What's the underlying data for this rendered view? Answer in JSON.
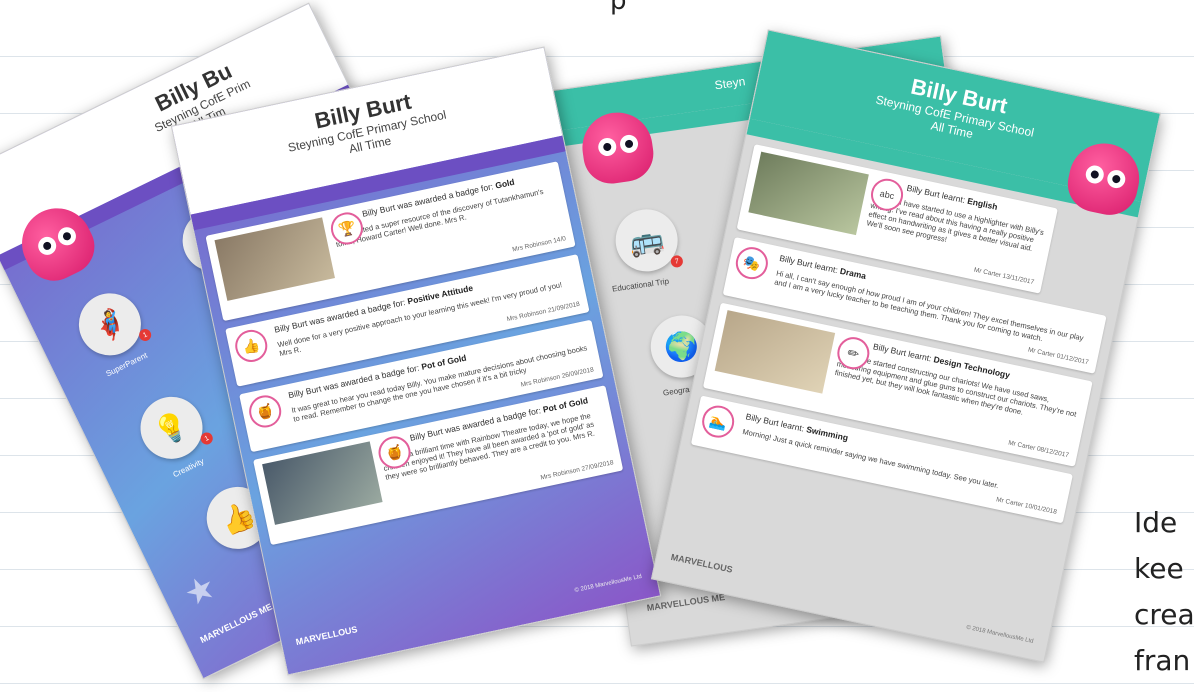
{
  "top_text": "p",
  "side_note": [
    "Ide",
    "kee",
    "crea",
    "fran"
  ],
  "sheet1": {
    "name": "Billy Bu",
    "school": "Steyning CofE Prim",
    "period": "All Tim",
    "badges": [
      {
        "label": "SuperParent",
        "icon": "superparent-icon",
        "count": "1"
      },
      {
        "label": "Creativity",
        "icon": "creativity-icon",
        "count": "1"
      },
      {
        "label": "",
        "icon": "gold-pot-icon",
        "count": ""
      },
      {
        "label": "",
        "icon": "thumbs-up-icon",
        "count": ""
      }
    ],
    "logo": "MARVELLOUS ME",
    "logo2": "MARVELLOUS"
  },
  "sheet2": {
    "name": "Billy Burt",
    "school": "Steyning CofE Primary School",
    "period": "All Time",
    "cards": [
      {
        "title_prefix": "Billy Burt was awarded a badge for:",
        "title_bold": "Gold",
        "body": "You created a super resource of the discovery of Tutankhamun's tomb, Howard Carter! Well done. Mrs R.",
        "meta": "Mrs Robinson 14/0",
        "icon": "trophy-icon",
        "photo": true
      },
      {
        "title_prefix": "Billy Burt was awarded a badge for:",
        "title_bold": "Positive Attitude",
        "body": "Well done for a very positive approach to your learning this week! I'm very proud of you! Mrs R.",
        "meta": "Mrs Robinson 21/09/2018",
        "icon": "thumbs-up-icon",
        "photo": false
      },
      {
        "title_prefix": "Billy Burt was awarded a badge for:",
        "title_bold": "Pot of Gold",
        "body": "It was great to hear you read today Billy. You make mature decisions about choosing books to read. Remember to change the one you have chosen if it's a bit tricky",
        "meta": "Mrs Robinson 26/09/2018",
        "icon": "gold-pot-icon",
        "photo": false
      },
      {
        "title_prefix": "Billy Burt was awarded a badge for:",
        "title_bold": "Pot of Gold",
        "body": "We had a brilliant time with Rainbow Theatre today, we hope the children enjoyed it! They have all been awarded a 'pot of gold' as they were so brilliantly behaved. They are a credit to you. Mrs R.",
        "meta": "Mrs Robinson 27/09/2018",
        "icon": "gold-pot-icon",
        "photo": true
      }
    ],
    "copyright": "© 2018 MarvellousMe Ltd"
  },
  "sheet3": {
    "name": "Steyn",
    "badges": [
      {
        "label": "Educational Trip",
        "icon": "school-bus-icon",
        "count": "7"
      },
      {
        "label": "Geogra",
        "icon": "globe-icon",
        "count": ""
      }
    ],
    "logo": "MARVELLOUS ME"
  },
  "sheet4": {
    "name": "Billy Burt",
    "school": "Steyning CofE Primary School",
    "period": "All Time",
    "cards": [
      {
        "title_prefix": "Billy Burt learnt:",
        "title_bold": "English",
        "body": "Hi both, I have started to use a highlighter with Billy's writing. I've read about this having a really positive effect on handwriting as it gives a better visual aid. We'll soon see progress!",
        "meta": "Mr Carter 13/11/2017",
        "icon": "abc-icon",
        "photo": true
      },
      {
        "title_prefix": "Billy Burt learnt:",
        "title_bold": "Drama",
        "body": "Hi all, I can't say enough of how proud I am of your children! They excel themselves in our play and I am a very lucky teacher to be teaching them. Thank you for coming to watch.",
        "meta": "Mr Carter 01/12/2017",
        "icon": "drama-masks-icon",
        "photo": false
      },
      {
        "title_prefix": "Billy Burt learnt:",
        "title_bold": "Design Technology",
        "body": "Today, we started constructing our chariots! We have used saws, measuring equipment and glue guns to construct our chariots. They're not finished yet, but they will look fantastic when they're done.",
        "meta": "Mr Carter 08/12/2017",
        "icon": "pencil-icon",
        "photo": true
      },
      {
        "title_prefix": "Billy Burt learnt:",
        "title_bold": "Swimming",
        "body": "Morning! Just a quick reminder saying we have swimming today. See you later.",
        "meta": "Mr Carter 10/01/2018",
        "icon": "swimming-icon",
        "photo": false
      }
    ],
    "logo": "MARVELLOUS",
    "copyright": "© 2018 MarvellousMe Ltd"
  }
}
